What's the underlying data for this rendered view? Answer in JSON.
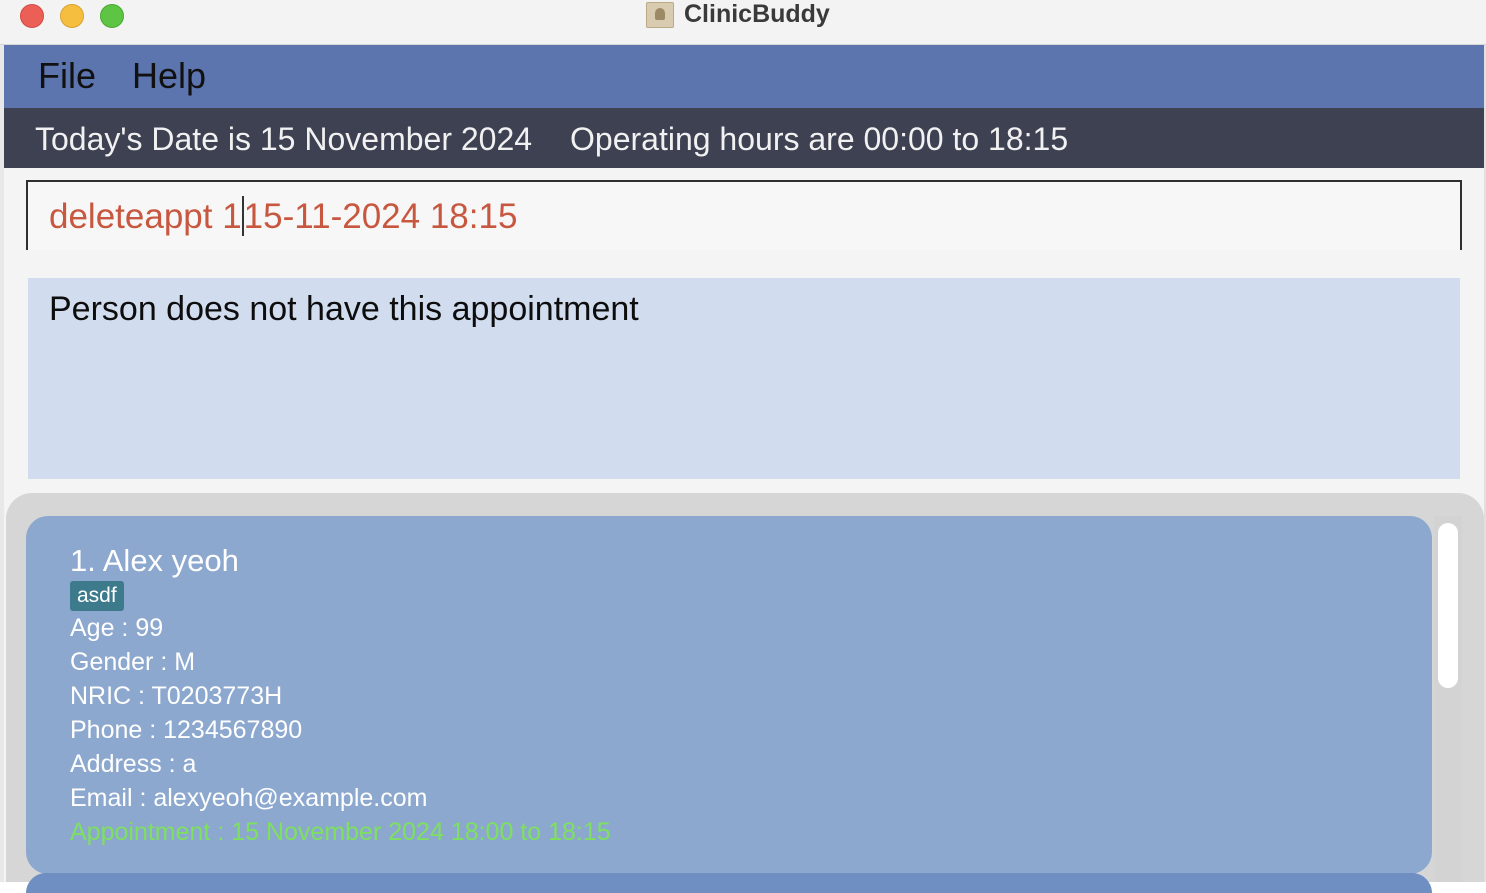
{
  "window": {
    "title": "ClinicBuddy",
    "icon": "address-book-icon",
    "controls": [
      "close",
      "minimize",
      "maximize"
    ]
  },
  "menu": {
    "file": "File",
    "help": "Help"
  },
  "status": {
    "date": "Today's Date is 15 November 2024",
    "hours": "Operating hours are 00:00 to 18:15"
  },
  "command": {
    "before_caret": "deleteappt 1",
    "after_caret": "15-11-2024 18:15"
  },
  "result": {
    "message": "Person does not have this appointment"
  },
  "persons": [
    {
      "name": "1. Alex yeoh",
      "tag": "asdf",
      "age": "Age : 99",
      "gender": "Gender : M",
      "nric": "NRIC : T0203773H",
      "phone": "Phone : 1234567890",
      "address": "Address : a",
      "email": "Email : alexyeoh@example.com",
      "appointment": "Appointment : 15 November 2024 18:00 to 18:15"
    }
  ],
  "colors": {
    "menubar": "#5c75af",
    "infobar": "#3d4152",
    "command_text": "#c8573f",
    "result_bg": "#d1ddee",
    "card_bg": "#8ca8cf",
    "tag_bg": "#3d7b8c",
    "appointment_text": "#7ee05f"
  }
}
